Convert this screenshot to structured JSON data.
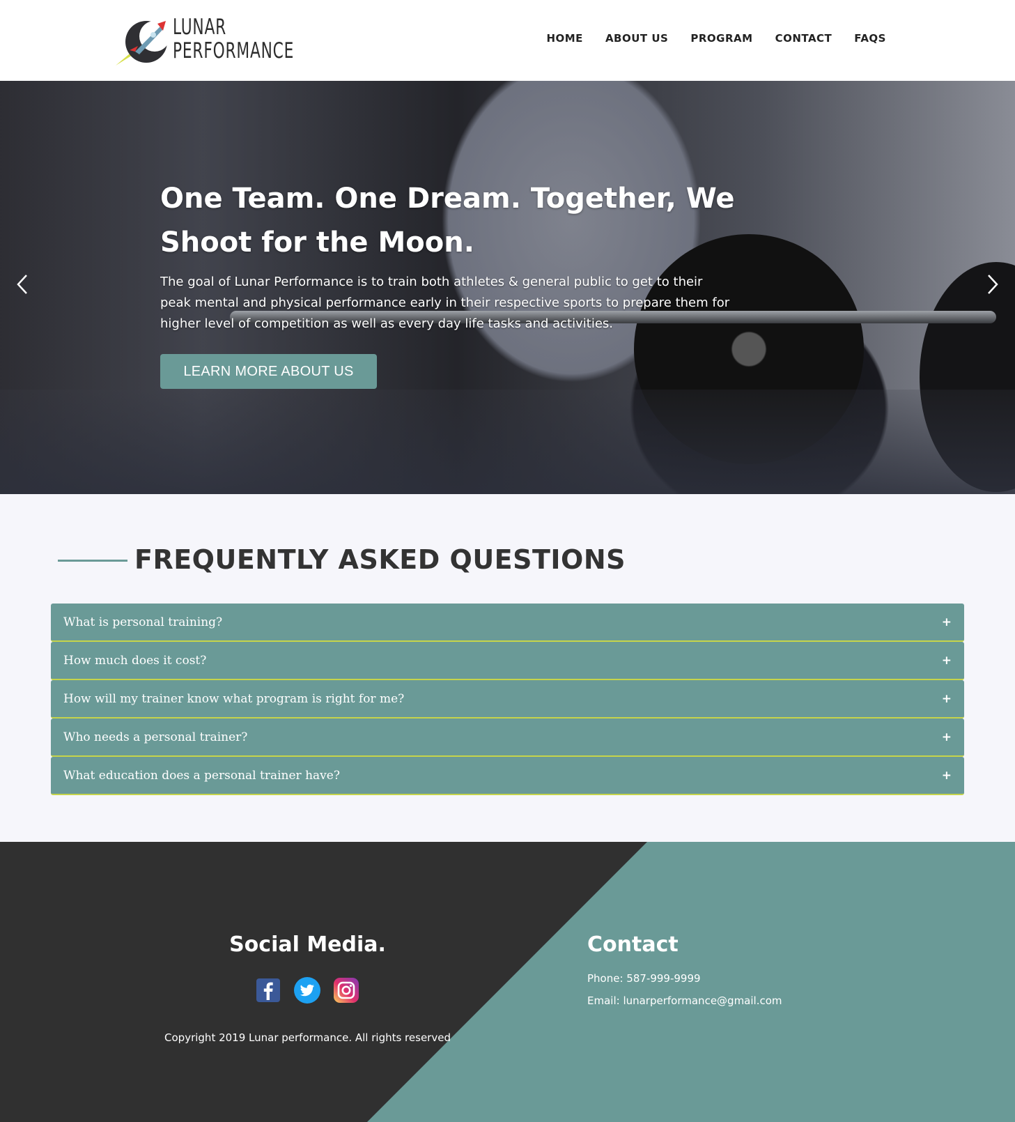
{
  "header": {
    "logo_line1": "LUNAR",
    "logo_line2": "PERFORMANCE",
    "nav": [
      "HOME",
      "ABOUT US",
      "PROGRAM",
      "CONTACT",
      "FAQS"
    ]
  },
  "hero": {
    "title": "One Team. One Dream. Together, We Shoot for the Moon.",
    "text": "The goal of Lunar Performance is to train both athletes & general public to get to their peak mental and physical performance early in their respective sports to prepare them for higher level of competition as well as every day life tasks and activities.",
    "button": "LEARN MORE ABOUT US"
  },
  "faq": {
    "heading": "FREQUENTLY ASKED QUESTIONS",
    "items": [
      "What is personal training?",
      "How much does it cost?",
      "How will my trainer know what program is right for me?",
      "Who needs a personal trainer?",
      "What education does a personal trainer have?"
    ],
    "toggle": "+"
  },
  "footer": {
    "social_title": "Social Media.",
    "copyright": "Copyright 2019 Lunar performance. All rights reserved",
    "contact_title": "Contact",
    "phone": "Phone: 587-999-9999",
    "email": "Email: lunarperformance@gmail.com"
  },
  "colors": {
    "accent": "#6a9a97",
    "faq_border": "#c6d44a",
    "footer_dark": "#303030"
  }
}
